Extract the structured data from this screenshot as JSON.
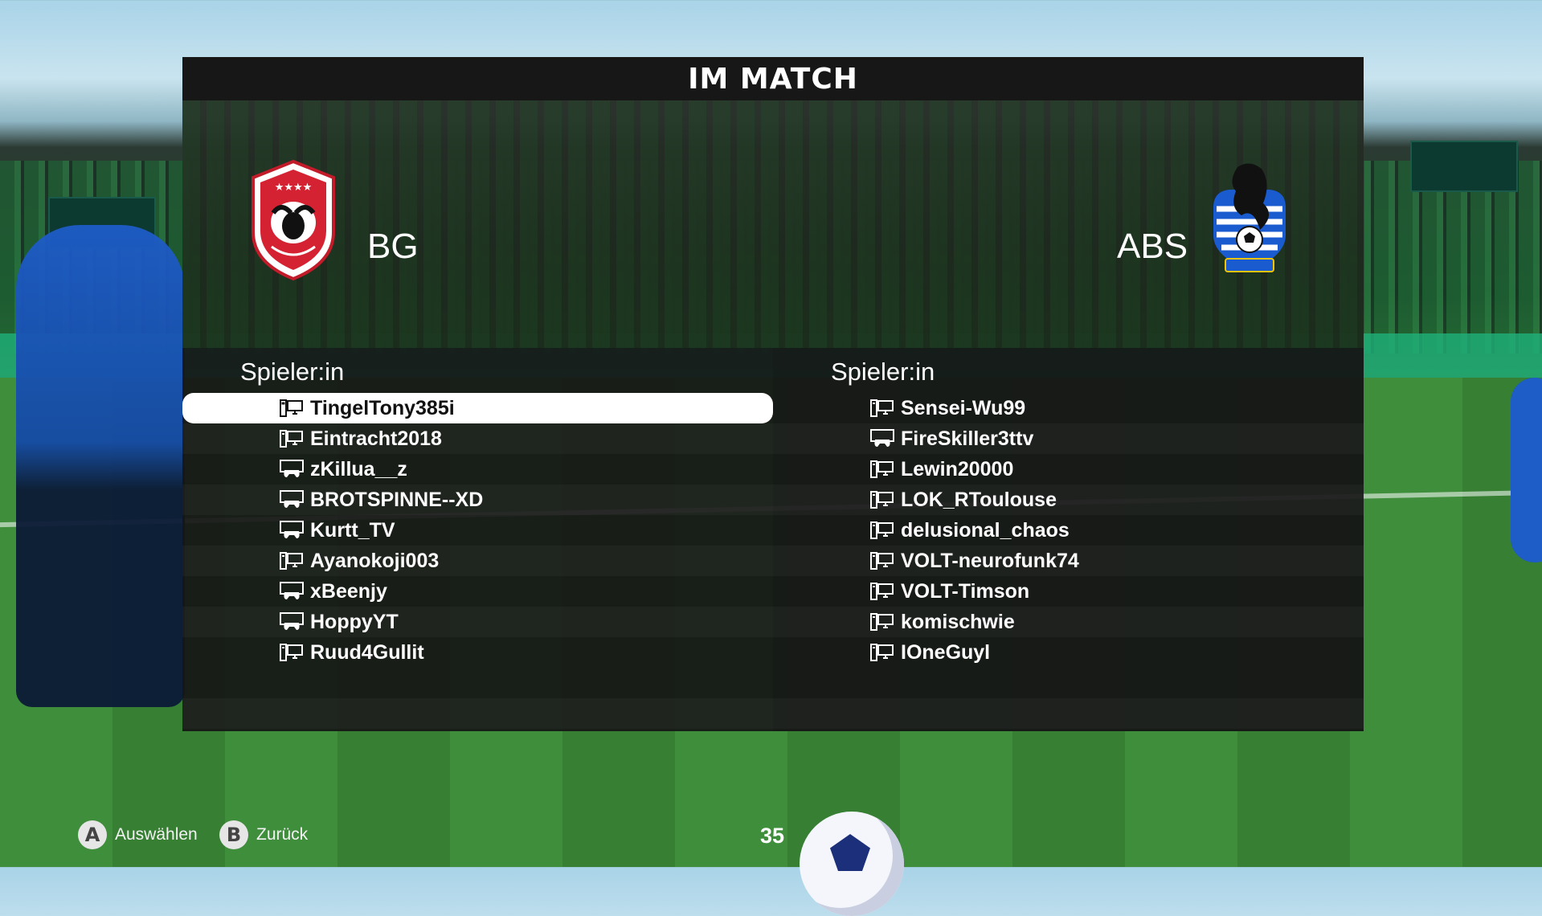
{
  "title": "IM MATCH",
  "teams": {
    "home": {
      "name": "BG",
      "crest_icon": "buffalo-crest-icon"
    },
    "away": {
      "name": "ABS",
      "crest_icon": "bear-crest-icon"
    }
  },
  "columns": {
    "home_header": "Spieler:in",
    "away_header": "Spieler:in"
  },
  "home_players": [
    {
      "name": "TingelTony385i",
      "platform": "pc-icon",
      "selected": true
    },
    {
      "name": "Eintracht2018",
      "platform": "pc-icon"
    },
    {
      "name": "zKillua__z",
      "platform": "console-icon"
    },
    {
      "name": "BROTSPINNE--XD",
      "platform": "console-icon"
    },
    {
      "name": "Kurtt_TV",
      "platform": "console-icon"
    },
    {
      "name": "Ayanokoji003",
      "platform": "pc-icon"
    },
    {
      "name": "xBeenjy",
      "platform": "console-icon"
    },
    {
      "name": "HoppyYT",
      "platform": "console-icon"
    },
    {
      "name": "Ruud4Gullit",
      "platform": "pc-icon"
    }
  ],
  "away_players": [
    {
      "name": "Sensei-Wu99",
      "platform": "pc-icon"
    },
    {
      "name": "FireSkiller3ttv",
      "platform": "console-icon"
    },
    {
      "name": "Lewin20000",
      "platform": "pc-icon"
    },
    {
      "name": "LOK_RToulouse",
      "platform": "pc-icon"
    },
    {
      "name": "delusional_chaos",
      "platform": "pc-icon"
    },
    {
      "name": "VOLT-neurofunk74",
      "platform": "pc-icon"
    },
    {
      "name": "VOLT-Timson",
      "platform": "pc-icon"
    },
    {
      "name": "komischwie",
      "platform": "pc-icon"
    },
    {
      "name": "IOneGuyl",
      "platform": "pc-icon"
    }
  ],
  "footer": {
    "select_button": "A",
    "select_label": "Auswählen",
    "back_button": "B",
    "back_label": "Zurück",
    "counter": "35"
  }
}
